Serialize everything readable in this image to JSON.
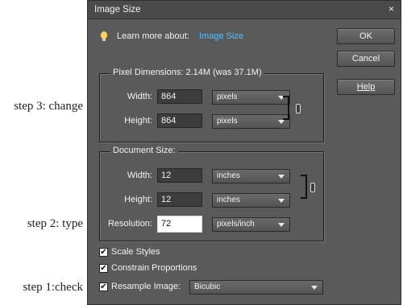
{
  "annotations": {
    "step3": "step 3: change",
    "step2": "step 2: type",
    "step1": "step 1:check"
  },
  "dialog": {
    "title": "Image Size",
    "close_glyph": "×",
    "learn_more_text": "Learn more about:",
    "learn_more_link": "Image Size"
  },
  "buttons": {
    "ok": "OK",
    "cancel": "Cancel",
    "help": "Help"
  },
  "pixel_dimensions": {
    "legend": "Pixel Dimensions:  2.14M (was 37.1M)",
    "width_label": "Width:",
    "width_value": "864",
    "width_unit": "pixels",
    "height_label": "Height:",
    "height_value": "864",
    "height_unit": "pixels"
  },
  "document_size": {
    "legend": "Document Size:",
    "width_label": "Width:",
    "width_value": "12",
    "width_unit": "inches",
    "height_label": "Height:",
    "height_value": "12",
    "height_unit": "inches",
    "resolution_label": "Resolution:",
    "resolution_value": "72",
    "resolution_unit": "pixels/inch"
  },
  "options": {
    "scale_styles": "Scale Styles",
    "constrain_proportions": "Constrain Proportions",
    "resample_label": "Resample Image:",
    "resample_value": "Bicubic",
    "check_glyph": "✔"
  },
  "colors": {
    "dialog_bg": "#5a5a5a",
    "link": "#4fc3ff"
  }
}
